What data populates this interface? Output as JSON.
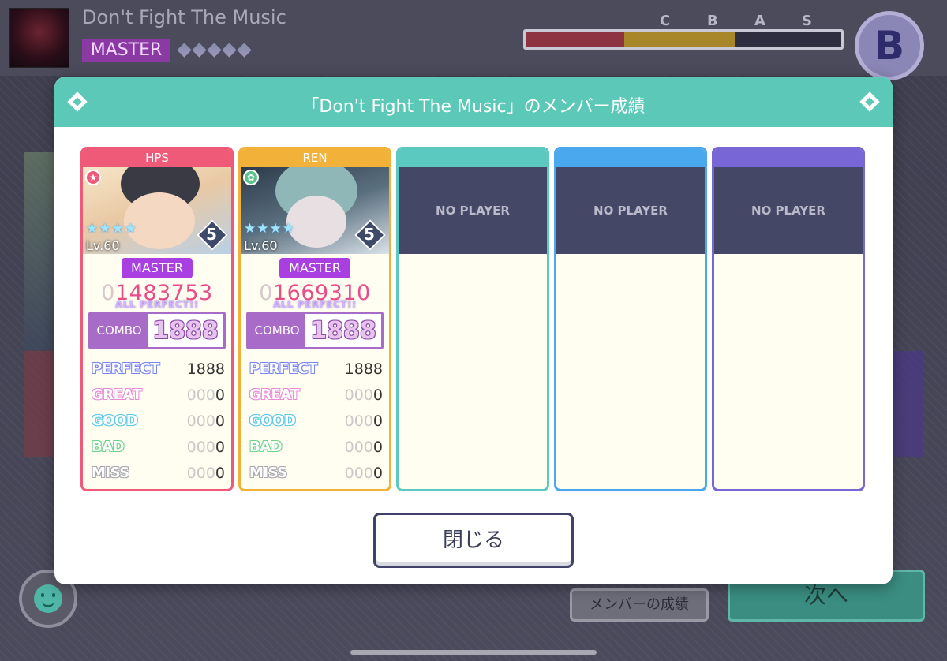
{
  "background": {
    "song_title": "Don't Fight The Music",
    "difficulty": "MASTER",
    "rank_letters": [
      "C",
      "B",
      "A",
      "S"
    ],
    "current_rank": "B",
    "members_button": "メンバーの成績",
    "next_button": "次へ"
  },
  "modal": {
    "title": "「Don't Fight The Music」のメンバー成績",
    "close_button": "閉じる",
    "colors": {
      "header": "#5cc9b8"
    },
    "players": [
      {
        "name": "HPS",
        "color": "#ee5a78",
        "level": "Lv.60",
        "rank": "5",
        "difficulty": "MASTER",
        "score_lead": "0",
        "score": "1483753",
        "full_combo_label": "ALL PERFECT!!",
        "combo_label": "COMBO",
        "combo": "1888",
        "judgements": {
          "perfect": {
            "label": "PERFECT",
            "lead": "",
            "value": "1888"
          },
          "great": {
            "label": "GREAT",
            "lead": "000",
            "value": "0"
          },
          "good": {
            "label": "GOOD",
            "lead": "000",
            "value": "0"
          },
          "bad": {
            "label": "BAD",
            "lead": "000",
            "value": "0"
          },
          "miss": {
            "label": "MISS",
            "lead": "000",
            "value": "0"
          }
        }
      },
      {
        "name": "REN",
        "color": "#f2b23a",
        "level": "Lv.60",
        "rank": "5",
        "difficulty": "MASTER",
        "score_lead": "0",
        "score": "1669310",
        "full_combo_label": "ALL PERFECT!!",
        "combo_label": "COMBO",
        "combo": "1888",
        "judgements": {
          "perfect": {
            "label": "PERFECT",
            "lead": "",
            "value": "1888"
          },
          "great": {
            "label": "GREAT",
            "lead": "000",
            "value": "0"
          },
          "good": {
            "label": "GOOD",
            "lead": "000",
            "value": "0"
          },
          "bad": {
            "label": "BAD",
            "lead": "000",
            "value": "0"
          },
          "miss": {
            "label": "MISS",
            "lead": "000",
            "value": "0"
          }
        }
      }
    ],
    "empty_slots": [
      {
        "label": "NO PLAYER",
        "color": "#5cc9c0"
      },
      {
        "label": "NO PLAYER",
        "color": "#4aa8ee"
      },
      {
        "label": "NO PLAYER",
        "color": "#7866d6"
      }
    ],
    "judge_colors": {
      "perfect": "#7a86f0",
      "great": "#e88ad8",
      "good": "#5ec8e8",
      "bad": "#6fd48a",
      "miss": "#a8a8b0"
    }
  }
}
